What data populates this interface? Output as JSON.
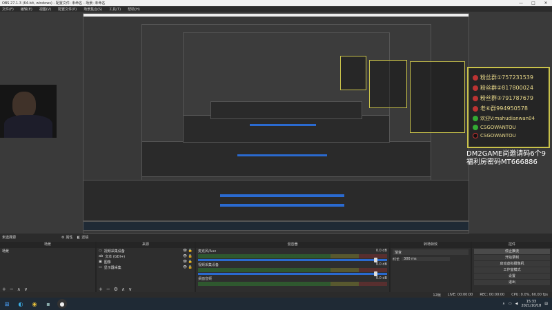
{
  "window": {
    "title": "OBS 27.1.3 (64-bit, windows) - 配置文件: 未命名 - 场景: 未命名",
    "controls": [
      "—",
      "□",
      "✕"
    ]
  },
  "menu": [
    "文件(F)",
    "编辑(E)",
    "视图(V)",
    "配置文件(P)",
    "场景集合(S)",
    "工具(T)",
    "帮助(H)"
  ],
  "overlay": {
    "lines": [
      {
        "icon": "pink-avatar-icon",
        "text": "粉丝群①757231539"
      },
      {
        "icon": "pink-avatar-icon",
        "text": "粉丝群②817800024"
      },
      {
        "icon": "pink-avatar-icon",
        "text": "粉丝群③791787679"
      },
      {
        "icon": "pink-avatar-icon",
        "text": "老⑥群994950578"
      },
      {
        "icon": "wechat-icon",
        "text": "欢迎V:mahudianwan04"
      },
      {
        "icon": "wechat-icon",
        "text": "CSGOWANTOU"
      },
      {
        "icon": "tiktok-icon",
        "text": "CSGOWANTOU"
      }
    ],
    "promo_line1": "DM2GAME尚邀请码6个9",
    "promo_line2": "福利房密码MT666886"
  },
  "scenebar": {
    "label": "未选择源",
    "props": "属性",
    "filters": "滤镜"
  },
  "scenes": {
    "title": "场景",
    "items": [
      "场景"
    ]
  },
  "sources": {
    "title": "来源",
    "items": [
      "视频采集设备",
      "文本 (GDI+)",
      "图像",
      "显示器采集"
    ]
  },
  "mixer": {
    "title": "混音器",
    "channels": [
      {
        "name": "麦克风/Aux",
        "db": "0.0 dB"
      },
      {
        "name": "视频采集设备",
        "db": "0.0 dB"
      },
      {
        "name": "桌面音频",
        "db": "0.0 dB"
      }
    ]
  },
  "transitions": {
    "title": "转场特效",
    "mode": "渐变",
    "duration_label": "时长",
    "duration_value": "300 ms"
  },
  "controls": {
    "title": "控件",
    "buttons": [
      "停止推流",
      "开始录制",
      "启动虚拟摄像机",
      "工作室模式",
      "设置",
      "退出"
    ]
  },
  "status": {
    "live": "LIVE: 00:00:00",
    "rec": "REC: 00:00:00",
    "cpu": "CPU: 0.0%, 60.00 fps",
    "dropped": "12帧"
  },
  "taskbar": {
    "time": "15:33",
    "date": "2021/10/18"
  }
}
